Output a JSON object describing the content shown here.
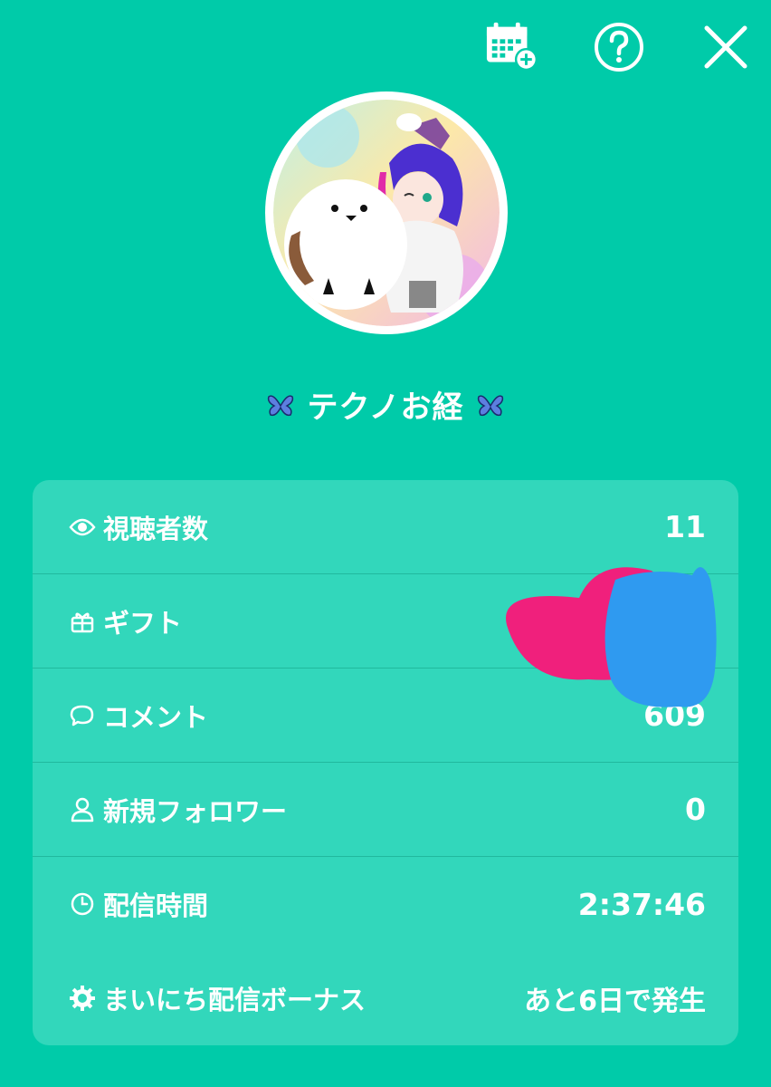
{
  "topbar": {
    "calendar_icon": "calendar-add-icon",
    "help_icon": "question-circle-icon",
    "close_icon": "close-icon"
  },
  "profile": {
    "username": "テクノお経",
    "username_decoration": "butterfly-emoji"
  },
  "stats": {
    "viewers": {
      "label": "視聴者数",
      "value": "11",
      "icon": "eye-icon"
    },
    "gifts": {
      "label": "ギフト",
      "value": "",
      "icon": "gift-icon"
    },
    "comments": {
      "label": "コメント",
      "value": "609",
      "icon": "speech-bubble-icon"
    },
    "new_followers": {
      "label": "新規フォロワー",
      "value": "0",
      "icon": "person-icon"
    },
    "duration": {
      "label": "配信時間",
      "value": "2:37:46",
      "icon": "clock-icon"
    },
    "daily_bonus": {
      "label": "まいにち配信ボーナス",
      "value": "あと6日で発生",
      "icon": "bonus-gear-icon"
    }
  },
  "colors": {
    "background": "#00CBA9",
    "card": "#32D7BB",
    "divider": "#20B99E",
    "scribble_pink": "#F0207C",
    "scribble_blue": "#2F9AF0"
  }
}
